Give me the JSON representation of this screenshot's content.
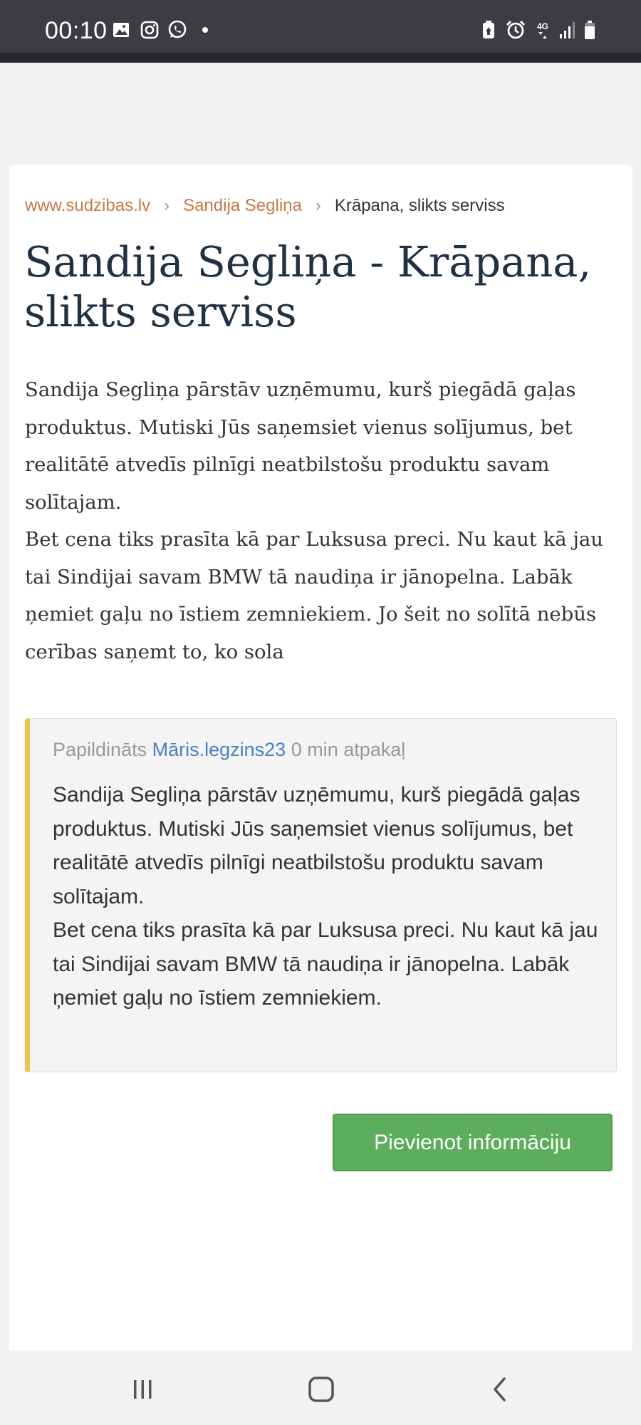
{
  "status_bar": {
    "time": "00:10",
    "icons": [
      "image-icon",
      "instagram-icon",
      "whatsapp-icon",
      "dot-icon",
      "battery-saver-icon",
      "alarm-icon",
      "network-4g-icon",
      "signal-icon",
      "battery-icon"
    ],
    "network_label": "4G"
  },
  "breadcrumb": {
    "home": "www.sudzibas.lv",
    "separator": "›",
    "company": "Sandija Segliņa",
    "current": "Krāpana, slikts serviss"
  },
  "page": {
    "title": "Sandija Segliņa - Krāpana, slikts serviss",
    "body_paragraph_1": "Sandija Segliņa pārstāv uzņēmumu, kurš piegādā gaļas produktus. Mutiski Jūs saņemsiet vienus solījumus, bet realitātē atvedīs pilnīgi neatbilstošu produktu savam solītajam.",
    "body_paragraph_2": "Bet cena tiks prasīta kā par Luksusa preci. Nu kaut kā jau tai Sindijai savam BMW tā naudiņa ir jānopelna. Labāk ņemiet gaļu no īstiem zemniekiem. Jo šeit no solītā nebūs cerības saņemt to, ko sola"
  },
  "update": {
    "prefix": "Papildināts",
    "author": "Māris.legzins23",
    "time_ago": "0 min atpakaļ",
    "text_paragraph_1": "Sandija Segliņa pārstāv uzņēmumu, kurš piegādā gaļas produktus. Mutiski Jūs saņemsiet vienus solījumus, bet realitātē atvedīs pilnīgi neatbilstošu produktu savam solītajam.",
    "text_paragraph_2": "Bet cena tiks prasīta kā par Luksusa preci. Nu kaut kā jau tai Sindijai savam BMW tā naudiņa ir jānopelna. Labāk ņemiet gaļu no īstiem zemniekiem.",
    "accent_color": "#f0c24b"
  },
  "actions": {
    "add_info_label": "Pievienot informāciju",
    "add_info_color": "#5cad5c"
  },
  "nav_bar": {
    "buttons": [
      "recent-apps-icon",
      "home-icon",
      "back-icon"
    ]
  },
  "colors": {
    "link": "#c87946",
    "title": "#1f3244",
    "author_link": "#4a7fc4",
    "status_bar": "#3c3d42"
  }
}
